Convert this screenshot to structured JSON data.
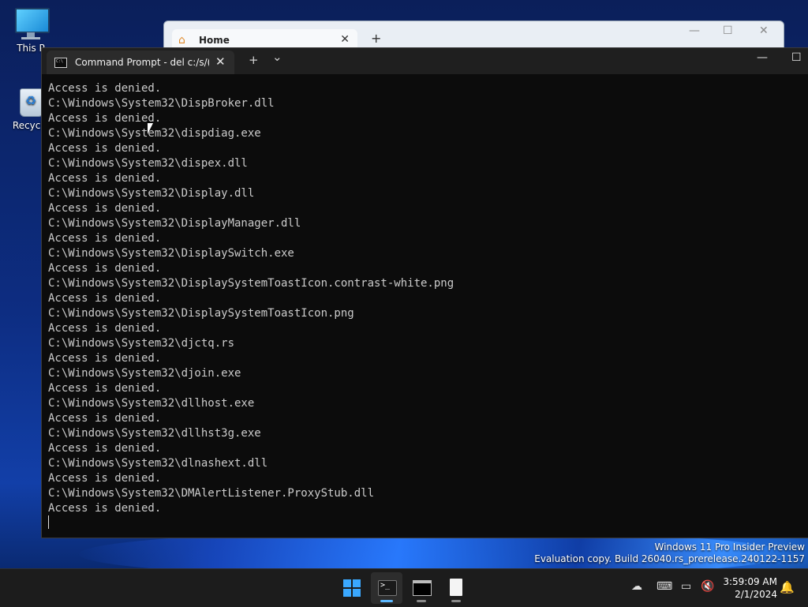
{
  "desktop": {
    "icons": [
      {
        "label": "This P",
        "icon": "this-pc-icon"
      },
      {
        "label": "Recycle",
        "icon": "recycle-bin-icon"
      }
    ]
  },
  "back_window": {
    "tab_label": "Home",
    "new_tab": "+",
    "minimize": "—",
    "maximize": "☐",
    "close": "✕"
  },
  "terminal": {
    "tab_title": "Command Prompt - del  c:/s/(",
    "tab_close": "✕",
    "new_tab": "+",
    "dropdown": "⌄",
    "minimize": "—",
    "maximize": "☐",
    "lines": [
      "Access is denied.",
      "C:\\Windows\\System32\\DispBroker.dll",
      "Access is denied.",
      "C:\\Windows\\System32\\dispdiag.exe",
      "Access is denied.",
      "C:\\Windows\\System32\\dispex.dll",
      "Access is denied.",
      "C:\\Windows\\System32\\Display.dll",
      "Access is denied.",
      "C:\\Windows\\System32\\DisplayManager.dll",
      "Access is denied.",
      "C:\\Windows\\System32\\DisplaySwitch.exe",
      "Access is denied.",
      "C:\\Windows\\System32\\DisplaySystemToastIcon.contrast-white.png",
      "Access is denied.",
      "C:\\Windows\\System32\\DisplaySystemToastIcon.png",
      "Access is denied.",
      "C:\\Windows\\System32\\djctq.rs",
      "Access is denied.",
      "C:\\Windows\\System32\\djoin.exe",
      "Access is denied.",
      "C:\\Windows\\System32\\dllhost.exe",
      "Access is denied.",
      "C:\\Windows\\System32\\dllhst3g.exe",
      "Access is denied.",
      "C:\\Windows\\System32\\dlnashext.dll",
      "Access is denied.",
      "C:\\Windows\\System32\\DMAlertListener.ProxyStub.dll",
      "Access is denied."
    ]
  },
  "watermark": {
    "line1": "Windows 11 Pro Insider Preview",
    "line2": "Evaluation copy. Build 26040.rs_prerelease.240122-1157"
  },
  "taskbar": {
    "apps": [
      "start-icon",
      "terminal-icon",
      "command-prompt-icon",
      "notepad-icon"
    ],
    "tray_icons": [
      "onedrive-offline-icon",
      "keyboard-icon",
      "network-icon",
      "volume-muted-icon"
    ],
    "time": "3:59:09 AM",
    "date": "2/1/2024",
    "notification_icon": "bell-icon"
  }
}
